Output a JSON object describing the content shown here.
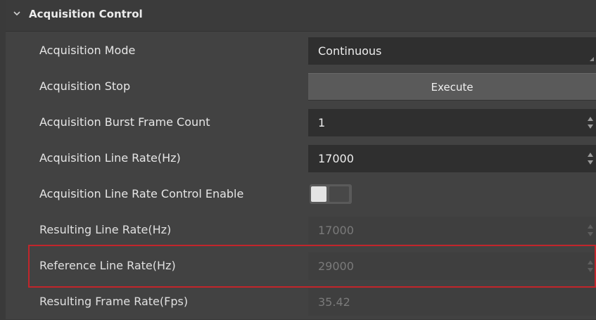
{
  "section": {
    "title": "Acquisition Control"
  },
  "rows": {
    "acquisition_mode": {
      "label": "Acquisition Mode",
      "value": "Continuous"
    },
    "acquisition_stop": {
      "label": "Acquisition Stop",
      "button": "Execute"
    },
    "burst_frame_count": {
      "label": "Acquisition Burst Frame Count",
      "value": "1"
    },
    "line_rate": {
      "label": "Acquisition Line Rate(Hz)",
      "value": "17000"
    },
    "line_rate_control_enable": {
      "label": "Acquisition Line Rate Control Enable",
      "enabled": false
    },
    "resulting_line_rate": {
      "label": "Resulting Line Rate(Hz)",
      "value": "17000"
    },
    "reference_line_rate": {
      "label": "Reference Line Rate(Hz)",
      "value": "29000"
    },
    "resulting_frame_rate": {
      "label": "Resulting Frame Rate(Fps)",
      "value": "35.42"
    }
  },
  "colors": {
    "highlight": "#c2252b",
    "background": "#424242",
    "input": "#2f2f2f"
  },
  "icons": {
    "collapse": "chevron-down-icon"
  }
}
